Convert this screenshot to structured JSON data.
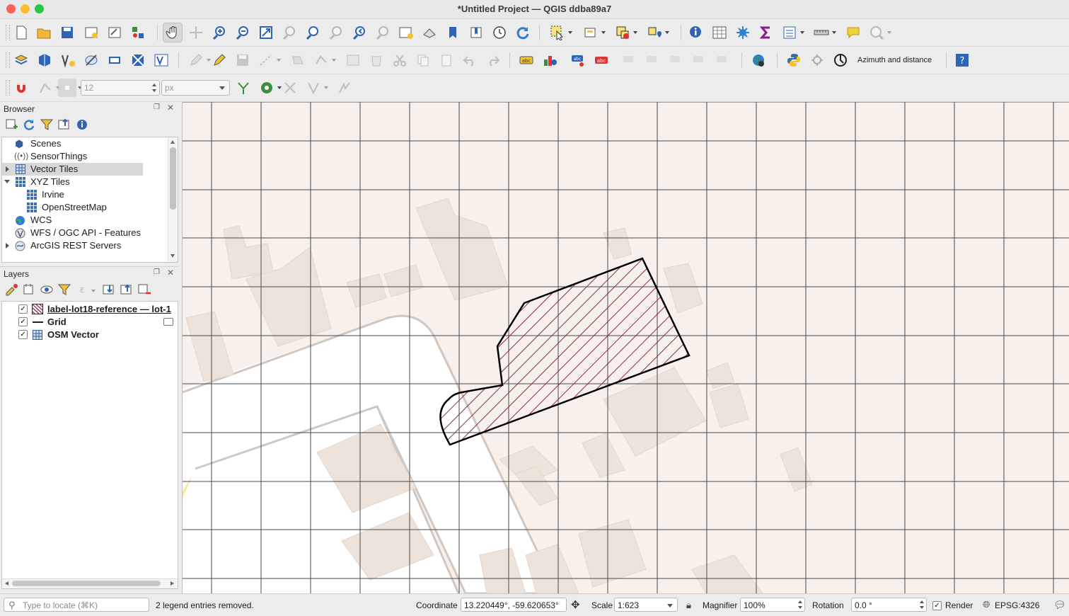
{
  "window": {
    "title": "*Untitled Project — QGIS ddba89a7"
  },
  "toolbar3": {
    "size_value": "12",
    "unit_value": "px"
  },
  "toolbar2": {
    "plugin_label": "Azimuth and distance"
  },
  "browser": {
    "title": "Browser",
    "items": [
      {
        "label": "Scenes"
      },
      {
        "label": "SensorThings"
      },
      {
        "label": "Vector Tiles"
      },
      {
        "label": "XYZ Tiles"
      },
      {
        "label": "Irvine"
      },
      {
        "label": "OpenStreetMap"
      },
      {
        "label": "WCS"
      },
      {
        "label": "WFS / OGC API - Features"
      },
      {
        "label": "ArcGIS REST Servers"
      }
    ]
  },
  "layers": {
    "title": "Layers",
    "items": [
      {
        "label": "label-lot18-reference — lot-1"
      },
      {
        "label": "Grid"
      },
      {
        "label": "OSM Vector"
      }
    ]
  },
  "status": {
    "locate_placeholder": "Type to locate (⌘K)",
    "message": "2 legend entries removed.",
    "coordinate_label": "Coordinate",
    "coordinate_value": "13.220449°, -59.620653°",
    "scale_label": "Scale",
    "scale_value": "1:623",
    "magnifier_label": "Magnifier",
    "magnifier_value": "100%",
    "rotation_label": "Rotation",
    "rotation_value": "0.0 °",
    "render_label": "Render",
    "crs": "EPSG:4326"
  },
  "colors": {
    "map_background": "#f8f1eb",
    "building": "#eee3da",
    "road": "#ffffff",
    "road_casing": "#cfc8c2",
    "grid_line": "#4a4a4a",
    "lot_hatch": "#8b2b4c",
    "lot_outline": "#000000",
    "park": "#fbe7a4"
  }
}
